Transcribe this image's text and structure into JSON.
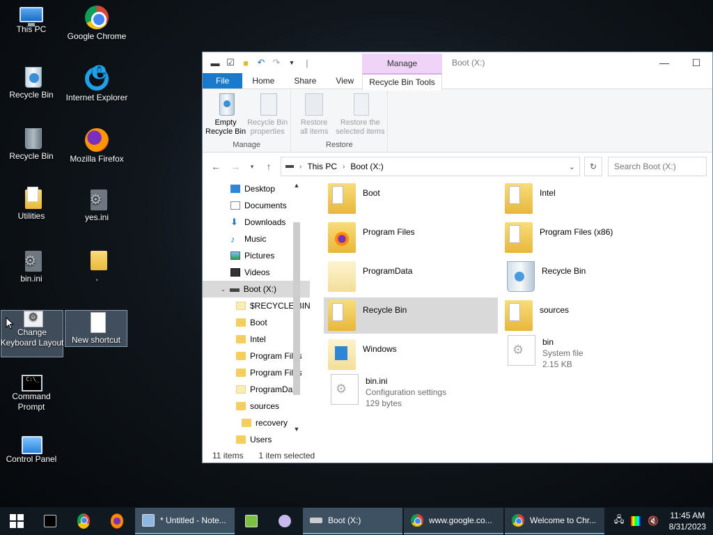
{
  "desktop": {
    "icons": [
      {
        "label": "This PC",
        "icon": "this-pc-icon"
      },
      {
        "label": "Google Chrome",
        "icon": "chrome-icon"
      },
      {
        "label": "Recycle Bin",
        "icon": "recycle-bin-full-icon"
      },
      {
        "label": "Internet Explorer",
        "icon": "internet-explorer-icon"
      },
      {
        "label": "Recycle Bin",
        "icon": "recycle-bin-empty-icon"
      },
      {
        "label": "Mozilla Firefox",
        "icon": "firefox-icon"
      },
      {
        "label": "Utilities",
        "icon": "folder-icon"
      },
      {
        "label": "yes.ini",
        "icon": "settings-file-icon"
      },
      {
        "label": "bin.ini",
        "icon": "settings-file-icon"
      },
      {
        "label": ",",
        "icon": "folder-icon"
      },
      {
        "label": "Change Keyboard Layout",
        "icon": "keyboard-settings-icon"
      },
      {
        "label": "New shortcut",
        "icon": "blank-document-icon"
      },
      {
        "label": "Command Prompt",
        "icon": "command-prompt-icon"
      },
      {
        "label": "Control Panel",
        "icon": "control-panel-icon"
      }
    ]
  },
  "window": {
    "title": "Boot (X:)",
    "context_tab_group": "Manage",
    "tabs": [
      "File",
      "Home",
      "Share",
      "View",
      "Recycle Bin Tools"
    ],
    "ribbon": {
      "groups": [
        {
          "label": "Manage",
          "buttons": [
            {
              "line1": "Empty",
              "line2": "Recycle Bin",
              "enabled": true
            },
            {
              "line1": "Recycle Bin",
              "line2": "properties",
              "enabled": false
            }
          ]
        },
        {
          "label": "Restore",
          "buttons": [
            {
              "line1": "Restore",
              "line2": "all items",
              "enabled": false
            },
            {
              "line1": "Restore the",
              "line2": "selected items",
              "enabled": false
            }
          ]
        }
      ]
    },
    "address": {
      "crumbs": [
        "This PC",
        "Boot (X:)"
      ],
      "search_placeholder": "Search Boot (X:)"
    },
    "nav_pane": [
      {
        "label": "Desktop",
        "icon": "desktop-icon",
        "level": 1
      },
      {
        "label": "Documents",
        "icon": "documents-icon",
        "level": 1
      },
      {
        "label": "Downloads",
        "icon": "downloads-icon",
        "level": 1
      },
      {
        "label": "Music",
        "icon": "music-icon",
        "level": 1
      },
      {
        "label": "Pictures",
        "icon": "pictures-icon",
        "level": 1
      },
      {
        "label": "Videos",
        "icon": "videos-icon",
        "level": 1
      },
      {
        "label": "Boot (X:)",
        "icon": "drive-icon",
        "level": 1,
        "selected": true
      },
      {
        "label": "$RECYCLE.BIN",
        "icon": "folder-pale-icon",
        "level": 2
      },
      {
        "label": "Boot",
        "icon": "folder-icon",
        "level": 2
      },
      {
        "label": "Intel",
        "icon": "folder-icon",
        "level": 2
      },
      {
        "label": "Program Files",
        "icon": "folder-icon",
        "level": 2
      },
      {
        "label": "Program Files",
        "icon": "folder-icon",
        "level": 2
      },
      {
        "label": "ProgramData",
        "icon": "folder-pale-icon",
        "level": 2
      },
      {
        "label": "sources",
        "icon": "folder-icon",
        "level": 2
      },
      {
        "label": "recovery",
        "icon": "folder-icon",
        "level": 3
      },
      {
        "label": "Users",
        "icon": "folder-icon",
        "level": 2
      }
    ],
    "items": [
      {
        "name": "Boot",
        "sub1": "",
        "sub2": "",
        "icon": "folder-doc-icon"
      },
      {
        "name": "Intel",
        "sub1": "",
        "sub2": "",
        "icon": "folder-doc-icon"
      },
      {
        "name": "Program Files",
        "sub1": "",
        "sub2": "",
        "icon": "folder-firefox-icon"
      },
      {
        "name": "Program Files (x86)",
        "sub1": "",
        "sub2": "",
        "icon": "folder-doc-icon"
      },
      {
        "name": "ProgramData",
        "sub1": "",
        "sub2": "",
        "icon": "folder-pale-icon"
      },
      {
        "name": "Recycle Bin",
        "sub1": "",
        "sub2": "",
        "icon": "recycle-bin-icon"
      },
      {
        "name": "Recycle Bin",
        "sub1": "",
        "sub2": "",
        "icon": "folder-doc-icon",
        "selected": true
      },
      {
        "name": "sources",
        "sub1": "",
        "sub2": "",
        "icon": "folder-doc-icon"
      },
      {
        "name": "Windows",
        "sub1": "",
        "sub2": "",
        "icon": "folder-windows-icon"
      },
      {
        "name": "bin",
        "sub1": "System file",
        "sub2": "2.15 KB",
        "icon": "system-file-icon"
      },
      {
        "name": "bin.ini",
        "sub1": "Configuration settings",
        "sub2": "129 bytes",
        "icon": "config-file-icon"
      }
    ],
    "status": {
      "count": "11 items",
      "selection": "1 item selected"
    }
  },
  "taskbar": {
    "tasks": [
      {
        "label": "* Untitled - Note...",
        "icon": "notepad-icon",
        "active": true
      },
      {
        "label": "Boot (X:)",
        "icon": "drive-icon",
        "active": true
      },
      {
        "label": "www.google.co...",
        "icon": "chrome-icon",
        "active": false
      },
      {
        "label": "Welcome to Chr...",
        "icon": "chrome-icon",
        "active": false
      }
    ],
    "clock": {
      "time": "11:45 AM",
      "date": "8/31/2023"
    }
  }
}
